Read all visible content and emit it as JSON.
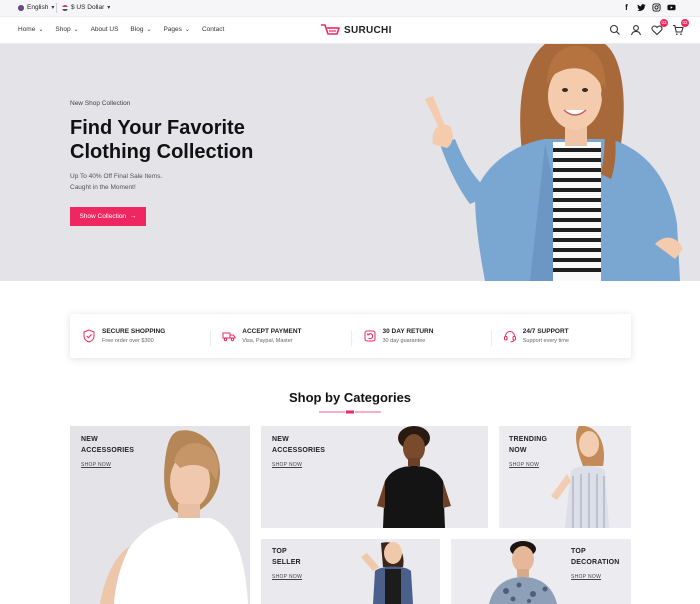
{
  "topbar": {
    "language": "English",
    "currency": "$ US Dollar",
    "social": [
      "facebook-icon",
      "twitter-icon",
      "instagram-icon",
      "youtube-icon"
    ]
  },
  "nav": {
    "items": [
      "Home",
      "Shop",
      "About US",
      "Blog",
      "Pages",
      "Contact"
    ]
  },
  "logo": {
    "name": "SURUCHI"
  },
  "header_badges": {
    "wishlist": "03",
    "cart": "02"
  },
  "hero": {
    "kicker": "New Shop Collection",
    "title": "Find Your Favorite Clothing Collection",
    "subtitle_line1": "Up To 40% Off Final Sale Items.",
    "subtitle_line2": "Caught in the Moment!",
    "cta": "Show Collection"
  },
  "features": [
    {
      "title": "SECURE SHOPPING",
      "subtitle": "Free order over $300",
      "icon": "shield-icon"
    },
    {
      "title": "ACCEPT PAYMENT",
      "subtitle": "Visa, Paypal, Master",
      "icon": "truck-icon"
    },
    {
      "title": "30 DAY RETURN",
      "subtitle": "30 day guarantee",
      "icon": "return-icon"
    },
    {
      "title": "24/7 SUPPORT",
      "subtitle": "Support every time",
      "icon": "headset-icon"
    }
  ],
  "categories": {
    "title": "Shop by Categories",
    "cards": [
      {
        "line1": "NEW",
        "line2": "ACCESSORIES",
        "link": "SHOP NOW"
      },
      {
        "line1": "NEW",
        "line2": "ACCESSORIES",
        "link": "SHOP NOW"
      },
      {
        "line1": "TRENDING",
        "line2": "NOW",
        "link": "SHOP NOW"
      },
      {
        "line1": "TOP",
        "line2": "SELLER",
        "link": "SHOP NOW"
      },
      {
        "line1": "TOP",
        "line2": "DECORATION",
        "link": "SHOP NOW"
      }
    ]
  },
  "colors": {
    "accent": "#ee2761",
    "hero_bg": "#e3e3e8",
    "card_bg": "#e9e9ee"
  }
}
